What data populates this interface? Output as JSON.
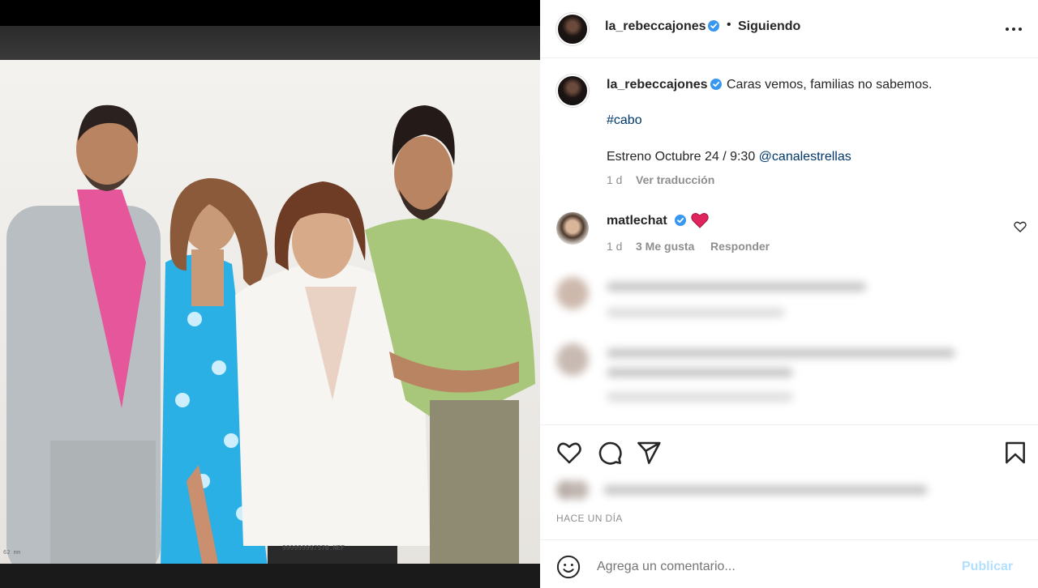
{
  "post": {
    "file_label": "999999997570.NEF",
    "mm_label": "62 mm"
  },
  "header": {
    "username": "la_rebeccajones",
    "separator": "•",
    "follow_status": "Siguiendo"
  },
  "caption": {
    "username": "la_rebeccajones",
    "text": "Caras vemos, familias no sabemos.",
    "hashtag": "#cabo",
    "premiere_text": "Estreno Octubre 24 / 9:30 ",
    "mention": "@canalestrellas",
    "age": "1 d",
    "translate": "Ver traducción"
  },
  "comment": {
    "username": "matlechat",
    "emoji": "❤",
    "age": "1 d",
    "likes": "3 Me gusta",
    "reply": "Responder"
  },
  "footer": {
    "time_ago": "HACE UN DÍA",
    "comment_placeholder": "Agrega un comentario...",
    "publish_label": "Publicar"
  },
  "icons": {
    "heart": "heart-icon",
    "comment": "comment-icon",
    "share": "send-icon",
    "save": "bookmark-icon",
    "emoji": "emoji-icon",
    "more": "more-icon"
  },
  "colors": {
    "link": "#00376b",
    "verified": "#3897f0",
    "muted": "#8e8e8e",
    "publish_disabled": "#b2dffc"
  }
}
